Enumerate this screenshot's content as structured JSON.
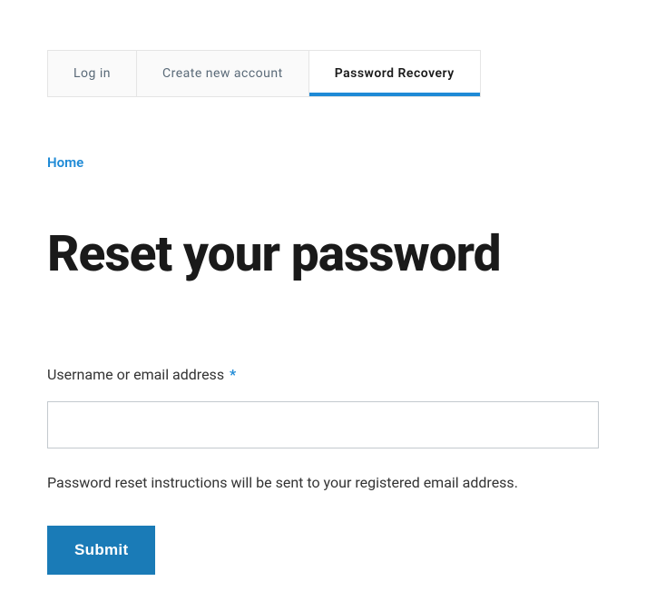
{
  "tabs": [
    {
      "label": "Log in"
    },
    {
      "label": "Create new account"
    },
    {
      "label": "Password Recovery"
    }
  ],
  "breadcrumb": {
    "home": "Home"
  },
  "page": {
    "title": "Reset your password"
  },
  "form": {
    "field_label": "Username or email address",
    "required_marker": "*",
    "help_text": "Password reset instructions will be sent to your registered email address.",
    "submit_label": "Submit"
  }
}
